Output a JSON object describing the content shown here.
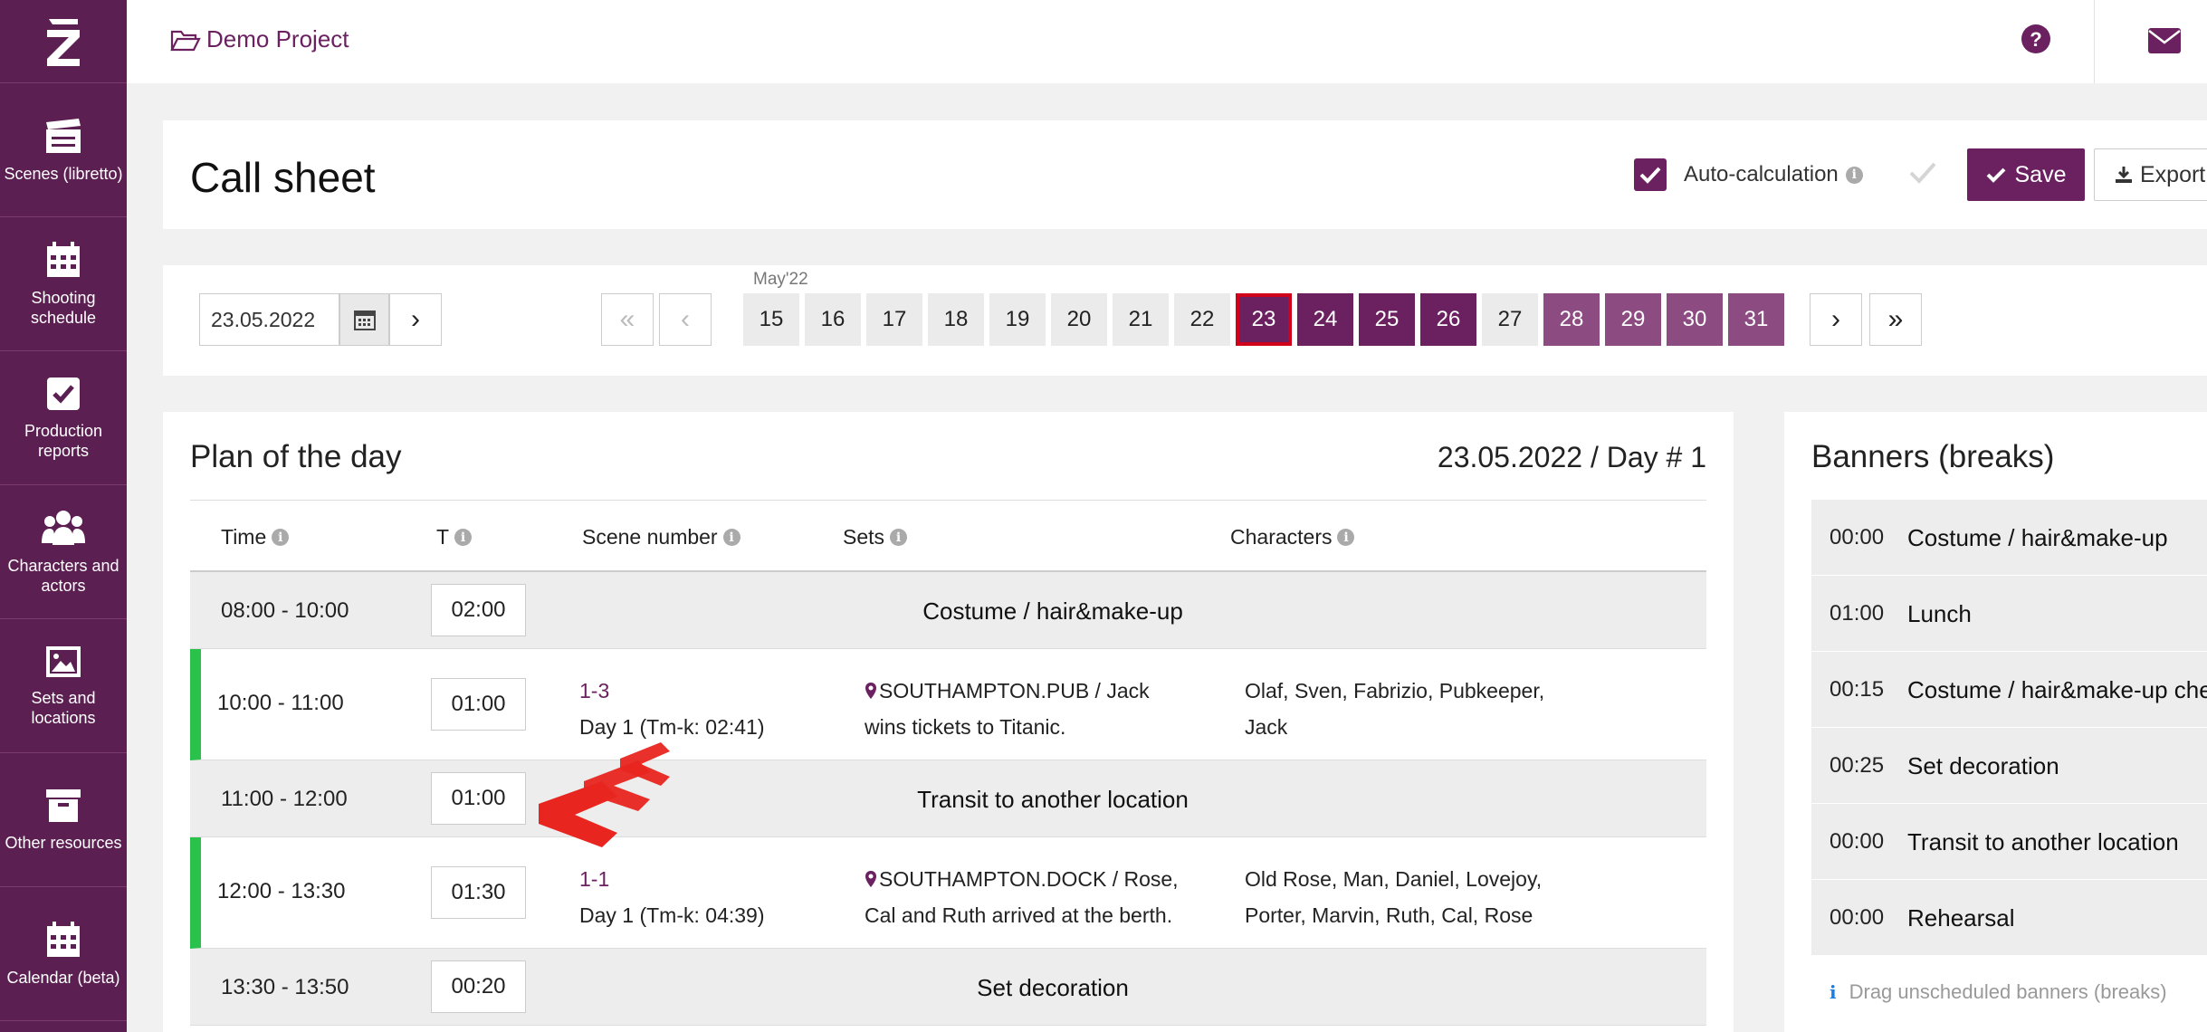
{
  "sidebar": {
    "logo": "Z",
    "items": [
      {
        "label": "Scenes (libretto)",
        "icon": "clapperboard-icon"
      },
      {
        "label": "Shooting schedule",
        "icon": "calendar-grid-icon"
      },
      {
        "label": "Production reports",
        "icon": "checkbox-icon"
      },
      {
        "label": "Characters and actors",
        "icon": "users-icon"
      },
      {
        "label": "Sets and locations",
        "icon": "image-icon"
      },
      {
        "label": "Other resources",
        "icon": "archive-box-icon"
      },
      {
        "label": "Calendar (beta)",
        "icon": "calendar-icon"
      }
    ]
  },
  "topbar": {
    "project": "Demo Project"
  },
  "header": {
    "title": "Call sheet",
    "auto_calc_label": "Auto-calculation",
    "save_label": "Save",
    "export_label": "Export"
  },
  "dates": {
    "current_date": "23.05.2022",
    "month_label": "May'22",
    "days": [
      "15",
      "16",
      "17",
      "18",
      "19",
      "20",
      "21",
      "22",
      "23",
      "24",
      "25",
      "26",
      "27",
      "28",
      "29",
      "30",
      "31"
    ],
    "selected_day": "23",
    "buttons": {
      "next": "›",
      "first": "«",
      "prev": "‹",
      "next2": "›",
      "last": "»"
    }
  },
  "plan": {
    "title": "Plan of the day",
    "date_day": "23.05.2022 / Day # 1",
    "columns": {
      "time": "Time",
      "t": "T",
      "scene": "Scene number",
      "sets": "Sets",
      "characters": "Characters"
    },
    "rows": [
      {
        "time": "08:00 - 10:00",
        "t": "02:00",
        "label": "Costume / hair&make-up"
      },
      {
        "time": "10:00 - 11:00",
        "t": "01:00",
        "scene": "1-3",
        "scene_day": "Day 1 (Tm-k: 02:41)",
        "sets_1": "SOUTHAMPTON.PUB / Jack",
        "sets_2": "wins tickets to Titanic.",
        "chars_1": "Olaf, Sven, Fabrizio, Pubkeeper,",
        "chars_2": "Jaсk"
      },
      {
        "time": "11:00 - 12:00",
        "t": "01:00",
        "label": "Transit to another location"
      },
      {
        "time": "12:00 - 13:30",
        "t": "01:30",
        "scene": "1-1",
        "scene_day": "Day 1 (Tm-k: 04:39)",
        "sets_1": "SOUTHAMPTON.DOCK / Rose,",
        "sets_2": "Cal and Ruth arrived at the berth.",
        "chars_1": "Old Rose, Man, Daniel, Lovejoy,",
        "chars_2": "Porter, Marvin, Ruth, Cal, Rose"
      },
      {
        "time": "13:30 - 13:50",
        "t": "00:20",
        "label": "Set decoration"
      }
    ]
  },
  "banners": {
    "title": "Banners (breaks)",
    "items": [
      {
        "time": "00:00",
        "name": "Costume / hair&make-up"
      },
      {
        "time": "01:00",
        "name": "Lunch"
      },
      {
        "time": "00:15",
        "name": "Costume / hair&make-up che"
      },
      {
        "time": "00:25",
        "name": "Set decoration"
      },
      {
        "time": "00:00",
        "name": "Transit to another location"
      },
      {
        "time": "00:00",
        "name": "Rehearsal"
      }
    ],
    "hint": "Drag unscheduled banners (breaks)"
  },
  "colors": {
    "brand": "#6b2160",
    "scene_bar": "#2bc24c",
    "selected_border": "#d0021b",
    "arrow": "#e8251f"
  }
}
